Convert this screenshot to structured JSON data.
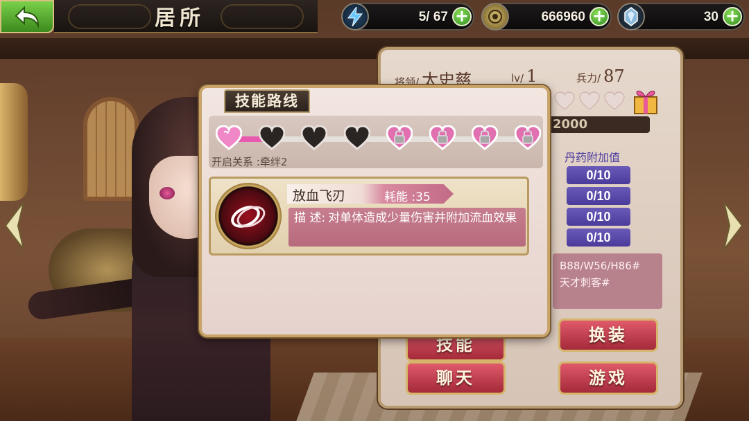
{
  "header": {
    "title": "居所",
    "resources": [
      {
        "icon": "lightning-icon",
        "value": "5/ 67"
      },
      {
        "icon": "coin-icon",
        "value": "666960"
      },
      {
        "icon": "crystal-icon",
        "value": "30"
      }
    ]
  },
  "info": {
    "general_label": "将领/",
    "general_name": "太史慈",
    "level_label": "lv/",
    "level_value": "1",
    "troops_label": "兵力/",
    "troops_value": "87",
    "exp_value": "2000",
    "pill_header": "丹药附加值",
    "pills": [
      "0/10",
      "0/10",
      "0/10",
      "0/10"
    ],
    "desc_line1": "B88/W56/H86#",
    "desc_line2": "天才刺客#",
    "buttons": {
      "skill": "技能",
      "outfit": "换装",
      "chat": "聊天",
      "game": "游戏"
    }
  },
  "modal": {
    "tab_title": "技能路线",
    "route_caption": "开启关系 :牵绊2",
    "nodes": [
      {
        "state": "active"
      },
      {
        "state": "dark"
      },
      {
        "state": "dark"
      },
      {
        "state": "dark"
      },
      {
        "state": "locked"
      },
      {
        "state": "locked"
      },
      {
        "state": "locked"
      },
      {
        "state": "locked"
      }
    ],
    "skill": {
      "name": "放血飞刃",
      "cost": "耗能 :35",
      "desc_label": "描 述:",
      "desc_text": "对单体造成少量伤害并附加流血效果"
    }
  },
  "colors": {
    "accent_pink": "#e85ab0",
    "button_red": "#c03a4a",
    "plus_green": "#4caf2e",
    "pill_purple": "#5a4aaa"
  }
}
